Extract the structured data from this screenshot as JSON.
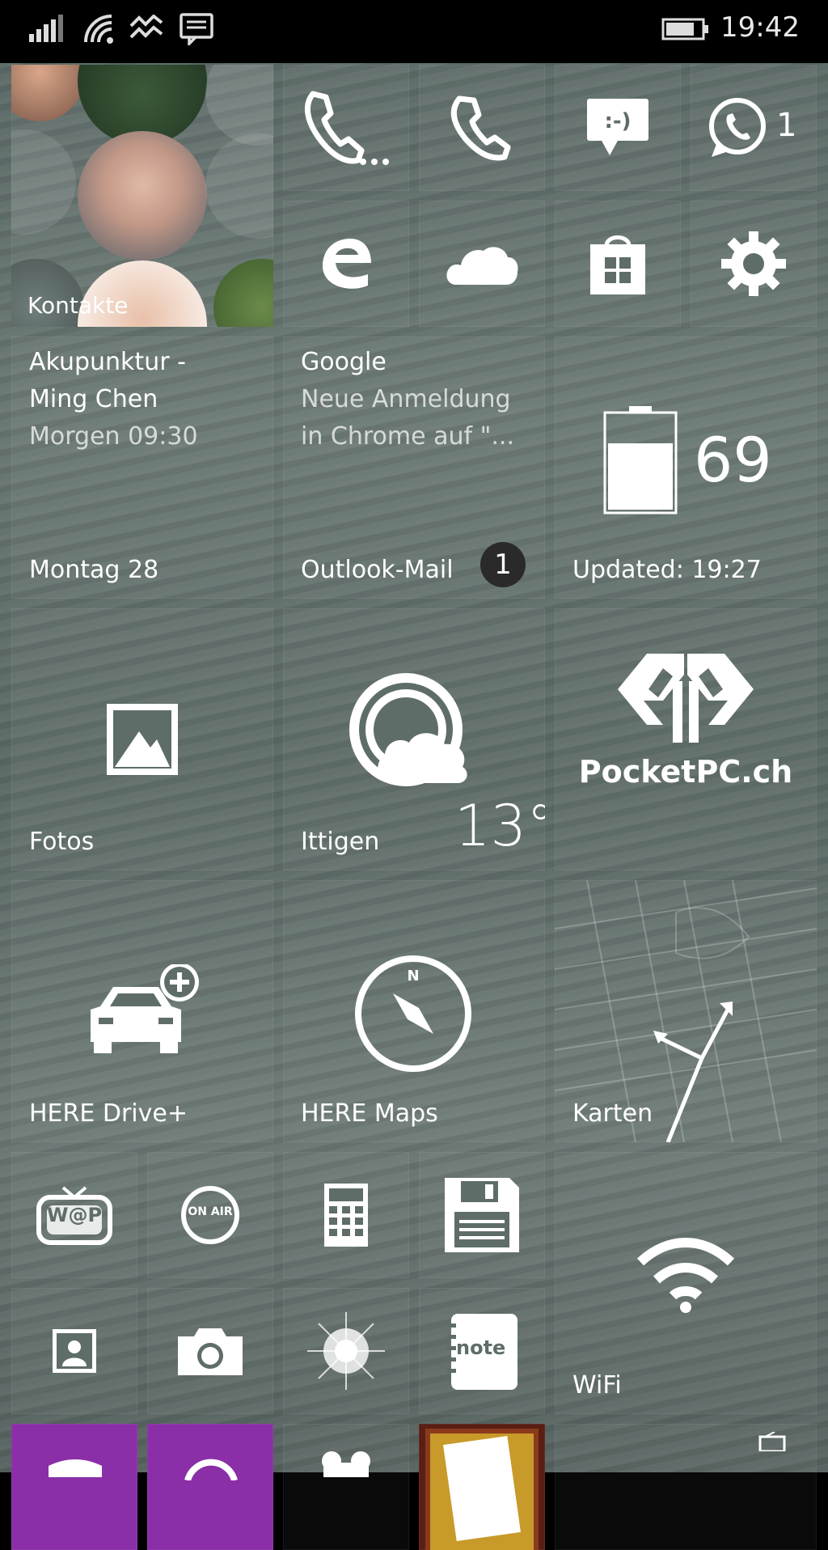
{
  "status_bar": {
    "time": "19:42"
  },
  "tiles": {
    "contacts": {
      "label": "Kontakte"
    },
    "phone_whatsapp_badge": "1",
    "calendar": {
      "title": "Akupunktur -",
      "title2": "Ming Chen",
      "when": "Morgen 09:30",
      "label": "Montag 28"
    },
    "mail": {
      "sender": "Google",
      "subject1": "Neue Anmeldung",
      "subject2": "in Chrome auf \"...",
      "label": "Outlook-Mail",
      "badge": "1"
    },
    "battery": {
      "value": "69",
      "label": "Updated: 19:27"
    },
    "photos": {
      "label": "Fotos"
    },
    "weather": {
      "label": "Ittigen",
      "temp": "13°"
    },
    "pocketpc": {
      "label": "PocketPC.ch"
    },
    "here_drive": {
      "label": "HERE Drive+"
    },
    "here_maps": {
      "label": "HERE Maps"
    },
    "maps": {
      "label": "Karten"
    },
    "wifi": {
      "label": "WiFi"
    },
    "onair": {
      "label": "ON AIR"
    },
    "wap": {
      "label": "W@P"
    },
    "note": {
      "label": "note"
    }
  },
  "colors": {
    "accent_purple": "#8a2fa8",
    "tile_bg": "#5f6d69"
  },
  "icons": [
    "signal-icon",
    "wifi-status-icon",
    "data-sense-icon",
    "message-notification-icon",
    "battery-status-icon",
    "phone-icon",
    "messaging-icon",
    "whatsapp-icon",
    "edge-icon",
    "onedrive-icon",
    "store-icon",
    "settings-icon",
    "photos-icon",
    "weather-icon",
    "pocketpc-logo",
    "car-add-icon",
    "compass-icon",
    "map-arrow-icon",
    "wifi-icon",
    "calculator-icon",
    "floppy-icon",
    "camera-icon",
    "flashlight-icon"
  ]
}
